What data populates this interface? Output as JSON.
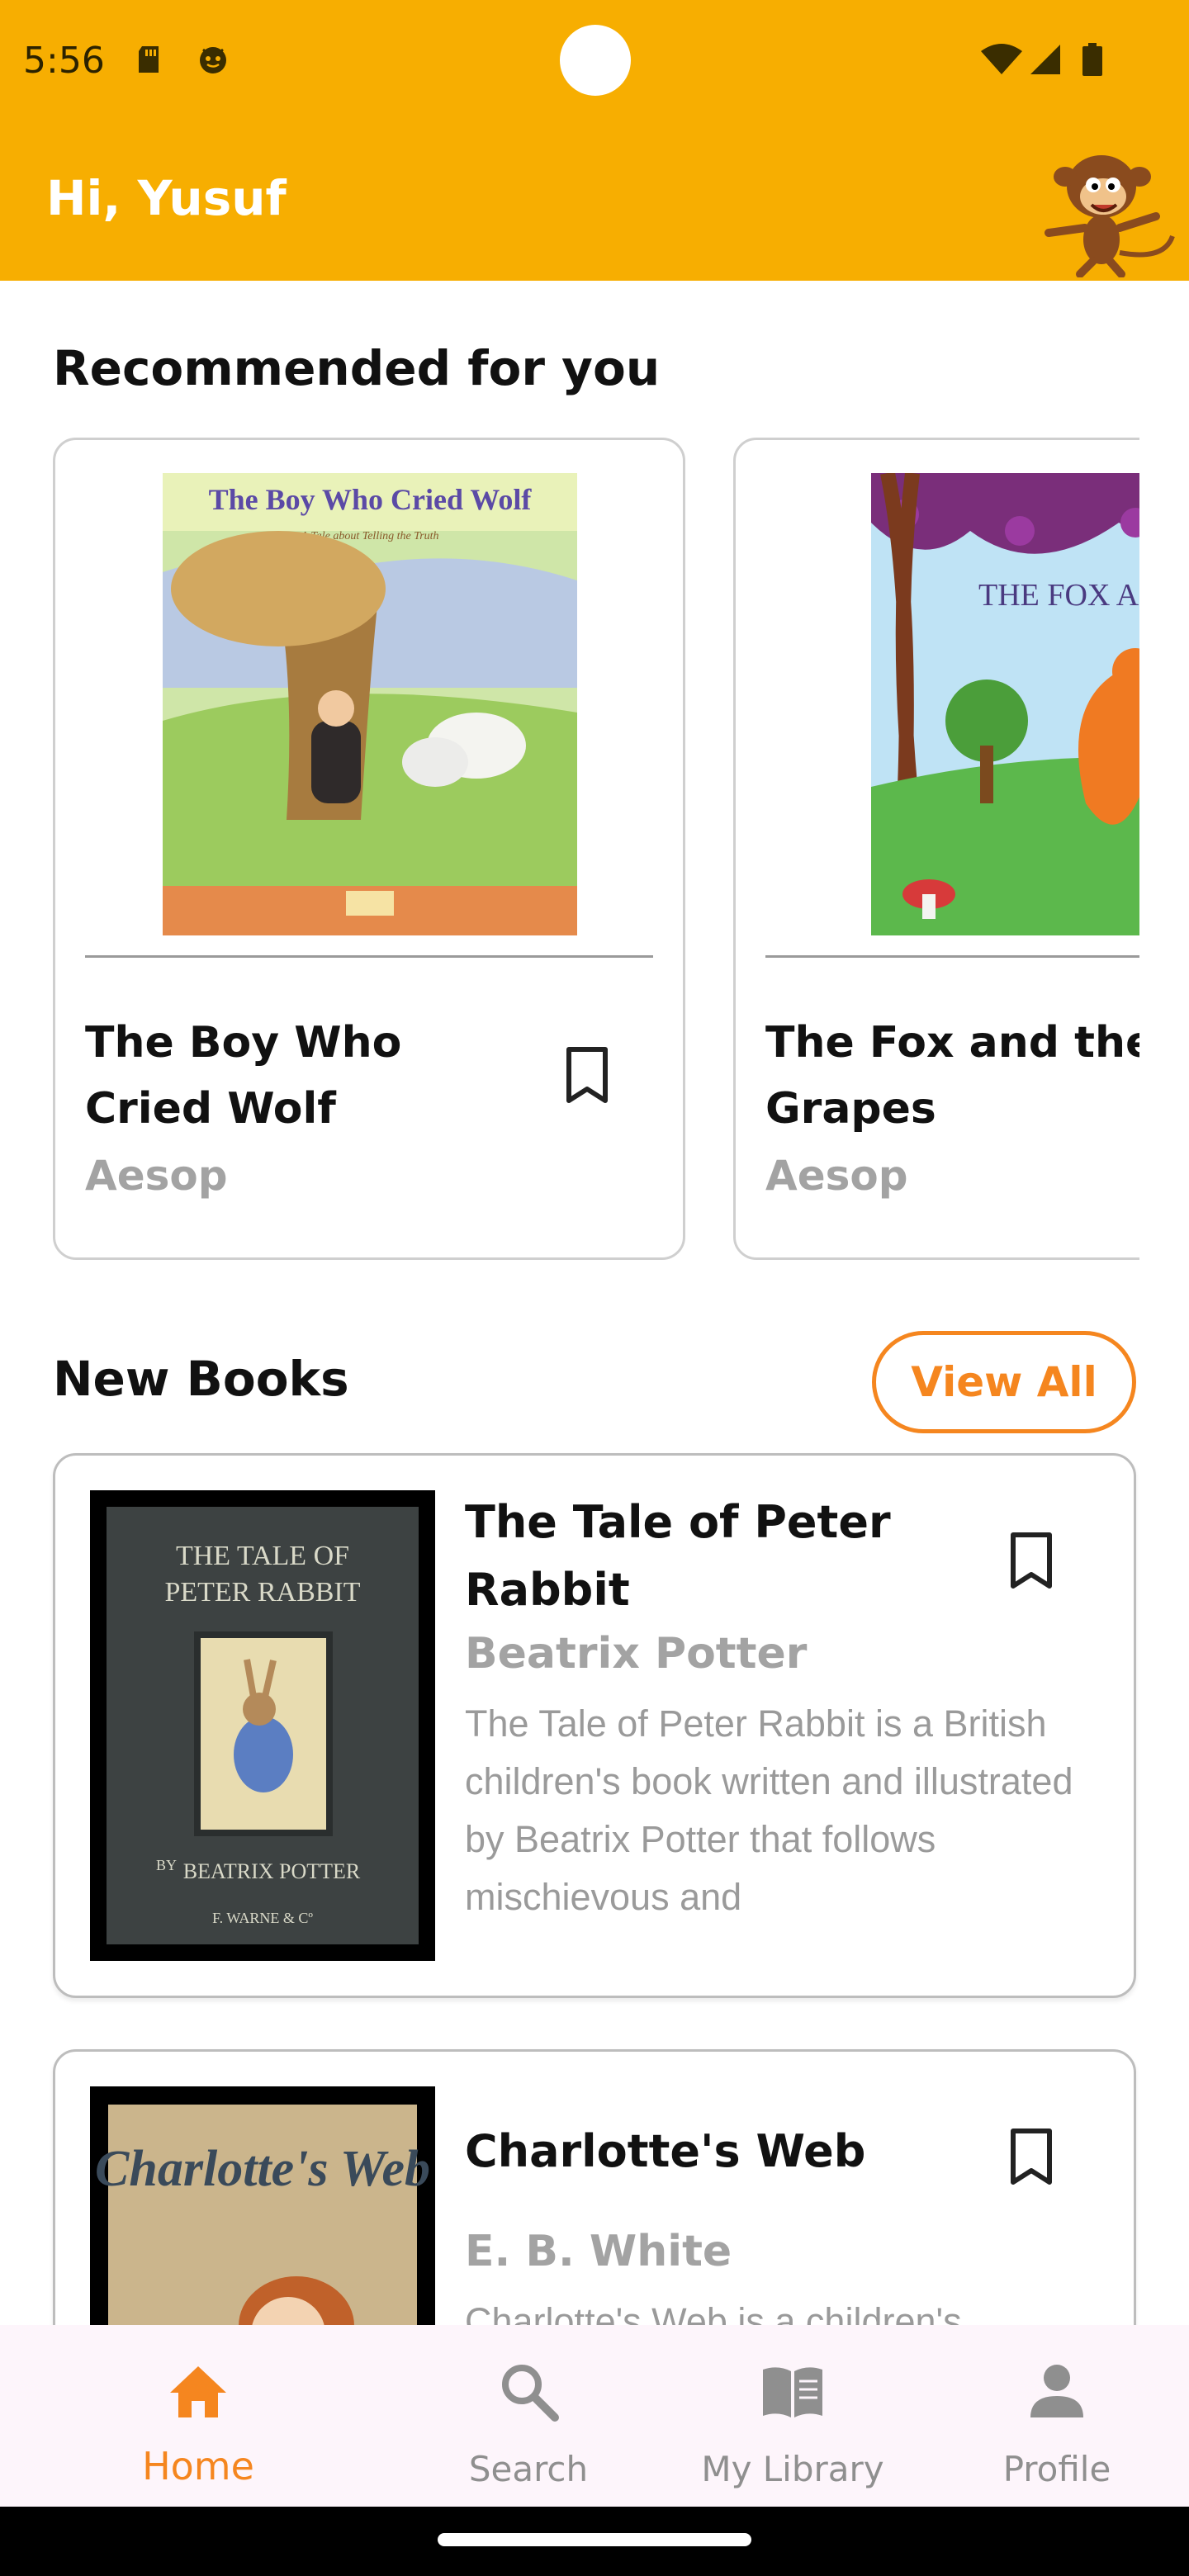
{
  "status_bar": {
    "time": "5:56",
    "icons": [
      "sd-card-icon",
      "notification-face-icon",
      "wifi-icon",
      "signal-icon",
      "battery-icon"
    ]
  },
  "header": {
    "greeting": "Hi, Yusuf",
    "mascot": "monkey-mascot",
    "background_color": "#F7AE01"
  },
  "recommended": {
    "title": "Recommended for you",
    "books": [
      {
        "title": "The Boy Who Cried Wolf",
        "author": "Aesop",
        "cover_text": "The Boy Who Cried Wolf",
        "cover_subtitle": "A Tale about Telling the Truth"
      },
      {
        "title": "The Fox and the Grapes",
        "author": "Aesop",
        "cover_text": "THE FOX A THE GRA"
      }
    ]
  },
  "new_books": {
    "title": "New Books",
    "view_all_label": "View All",
    "books": [
      {
        "title": "The Tale of Peter Rabbit",
        "author": "Beatrix Potter",
        "description": "The Tale of Peter Rabbit is a British children's book written and illustrated by Beatrix Potter that follows mischievous and",
        "cover_line1": "THE TALE OF",
        "cover_line2": "PETER RABBIT",
        "cover_by": "BY",
        "cover_author": "BEATRIX POTTER",
        "cover_publisher": "F. WARNE & Cº"
      },
      {
        "title": "Charlotte's Web",
        "author": "E. B. White",
        "description": "Charlotte's Web is a children's",
        "cover_text": "Charlotte's Web"
      }
    ]
  },
  "bottom_nav": {
    "items": [
      {
        "label": "Home",
        "icon": "home-icon",
        "active": true
      },
      {
        "label": "Search",
        "icon": "search-icon",
        "active": false
      },
      {
        "label": "My Library",
        "icon": "library-book-icon",
        "active": false
      },
      {
        "label": "Profile",
        "icon": "person-icon",
        "active": false
      }
    ]
  },
  "colors": {
    "primary": "#F7AE01",
    "accent": "#F5861F",
    "muted_text": "#A3A3A3"
  }
}
